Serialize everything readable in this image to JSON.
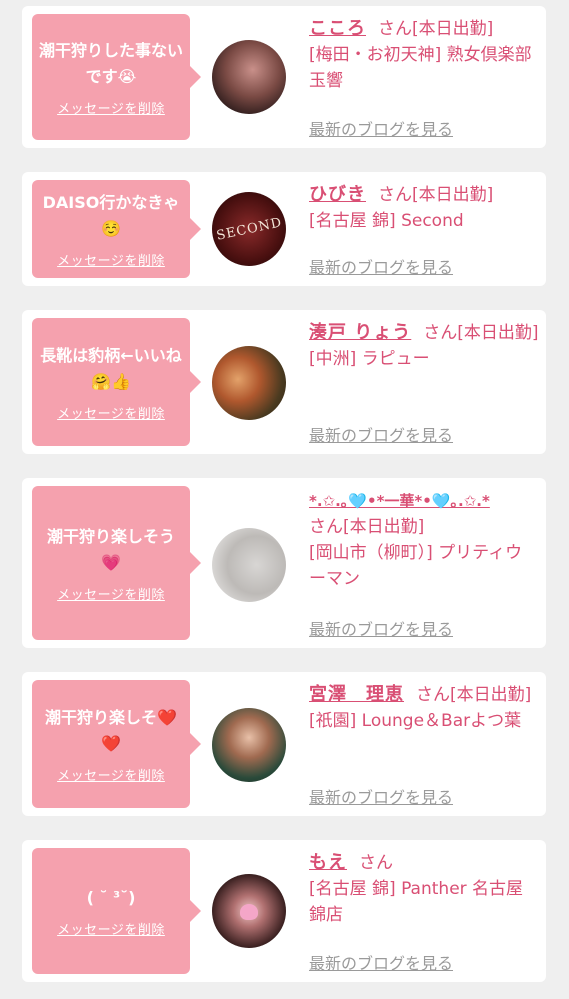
{
  "cards": [
    {
      "message": "潮干狩りした事ないです😭",
      "delete_label": "メッセージを削除",
      "name": "こころ",
      "san": "さん",
      "status": "[本日出勤]",
      "shop": "[梅田・お初天神] 熟女倶楽部 玉響",
      "blog_label": "最新のブログを見る"
    },
    {
      "message": "DAISO行かなきゃ☺️",
      "delete_label": "メッセージを削除",
      "name": "ひびき",
      "san": "さん",
      "status": "[本日出勤]",
      "shop": "[名古屋 錦] Second",
      "blog_label": "最新のブログを見る",
      "avatar_text": "SECOND"
    },
    {
      "message": "長靴は豹柄←いいね🤗👍",
      "delete_label": "メッセージを削除",
      "name": "湊戸 りょう",
      "san": "さん",
      "status": "[本日出勤]",
      "shop": "[中洲] ラピュー",
      "blog_label": "最新のブログを見る"
    },
    {
      "message": "潮干狩り楽しそう💗",
      "delete_label": "メッセージを削除",
      "name": "*.✩.｡🩵•*一華*•🩵｡.✩.*",
      "san": "さん",
      "status": "[本日出勤]",
      "shop": "[岡山市（柳町）] プリティウーマン",
      "blog_label": "最新のブログを見る"
    },
    {
      "message": "潮干狩り楽しそ❤️❤️",
      "delete_label": "メッセージを削除",
      "name": "宮澤　理恵",
      "san": "さん",
      "status": "[本日出勤]",
      "shop": "[祇園] Lounge＆Barよつ葉",
      "blog_label": "最新のブログを見る"
    },
    {
      "message": "( ˘ ³˘)",
      "delete_label": "メッセージを削除",
      "name": "もえ",
      "san": "さん",
      "status": "",
      "shop": "[名古屋 錦] Panther 名古屋錦店",
      "blog_label": "最新のブログを見る"
    }
  ]
}
